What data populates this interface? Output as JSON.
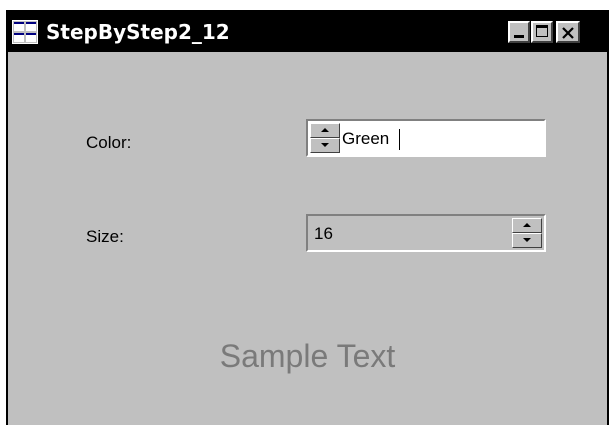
{
  "window": {
    "title": "StepByStep2_12",
    "icon": "app-window-icon"
  },
  "caption_buttons": {
    "minimize_icon": "minimize-icon",
    "maximize_icon": "maximize-icon",
    "close_icon": "close-icon"
  },
  "form": {
    "color_label": "Color:",
    "color_value": "Green",
    "size_label": "Size:",
    "size_value": "16"
  },
  "sample": {
    "text": "Sample Text",
    "color": "#7a7a7a"
  },
  "colors": {
    "titlebar": "#000000",
    "client": "#c0c0c0",
    "title_text": "#ffffff"
  }
}
